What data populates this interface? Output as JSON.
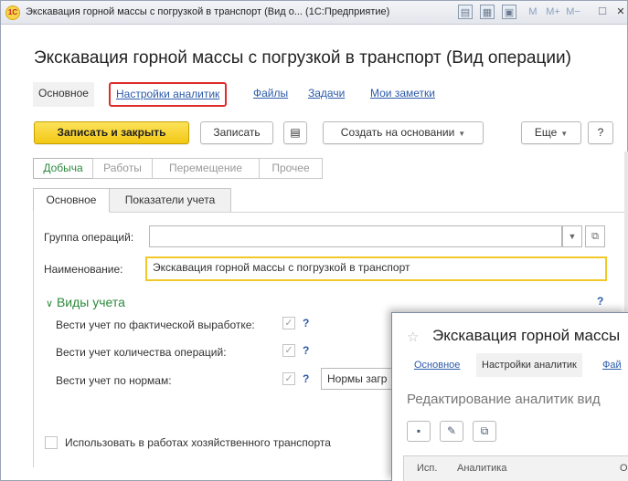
{
  "window": {
    "title": "Экскавация горной массы с погрузкой в транспорт (Вид о... (1С:Предприятие)",
    "logo_text": "1С",
    "memory_buttons": [
      "M",
      "M+",
      "M−"
    ]
  },
  "page_title": "Экскавация горной массы с погрузкой в транспорт (Вид операции)",
  "nav_tabs": [
    {
      "label": "Основное"
    },
    {
      "label": "Настройки аналитик"
    },
    {
      "label": "Файлы"
    },
    {
      "label": "Задачи"
    },
    {
      "label": "Мои заметки"
    }
  ],
  "toolbar": {
    "save_close": "Записать и закрыть",
    "save": "Записать",
    "create_based_on": "Создать на основании",
    "more": "Еще",
    "help": "?"
  },
  "filters": [
    "Добыча",
    "Работы",
    "Перемещение",
    "Прочее"
  ],
  "tabs": [
    "Основное",
    "Показатели учета"
  ],
  "form": {
    "group_label": "Группа операций:",
    "group_value": "",
    "name_label": "Наименование:",
    "name_value": "Экскавация горной массы с погрузкой в транспорт"
  },
  "section": {
    "title": "Виды учета",
    "help": "?",
    "rows": [
      {
        "label": "Вести учет по фактической выработке:",
        "checked": true,
        "help": "?"
      },
      {
        "label": "Вести учет количества операций:",
        "checked": true,
        "help": "?"
      },
      {
        "label": "Вести учет по нормам:",
        "checked": true,
        "help": "?",
        "field_value": "Нормы загр"
      }
    ]
  },
  "bottom_checkbox": {
    "label": "Использовать в работах хозяйственного транспорта",
    "checked": false
  },
  "overlay": {
    "title": "Экскавация горной массы",
    "tabs": [
      {
        "label": "Основное"
      },
      {
        "label": "Настройки аналитик"
      },
      {
        "label": "Фай"
      }
    ],
    "subtitle": "Редактирование аналитик вид",
    "columns": [
      "Исп.",
      "Аналитика",
      "Об"
    ]
  }
}
